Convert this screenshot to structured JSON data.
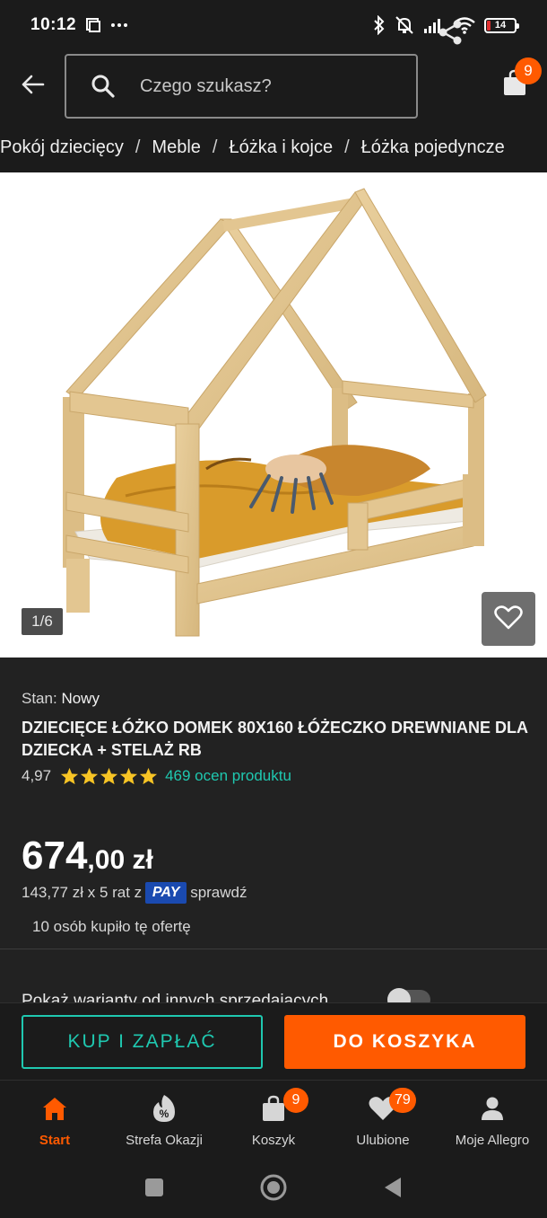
{
  "status_bar": {
    "time": "10:12",
    "battery_level": "14",
    "icons": [
      "screenshot-icon",
      "more-icon",
      "bluetooth-icon",
      "mute-icon",
      "signal-icon",
      "wifi-icon",
      "battery-icon"
    ]
  },
  "header": {
    "search_placeholder": "Czego szukasz?",
    "cart_count": "9"
  },
  "breadcrumb": [
    "Pokój dziecięcy",
    "Meble",
    "Łóżka i kojce",
    "Łóżka pojedyncze"
  ],
  "gallery": {
    "counter": "1/6"
  },
  "product": {
    "condition_label": "Stan:",
    "condition_value": "Nowy",
    "title": "DZIECIĘCE ŁÓŻKO DOMEK 80X160 ŁÓŻECZKO DREWNIANE DLA DZIECKA + STELAŻ RB",
    "rating_value": "4,97",
    "rating_stars": 5,
    "reviews_text": "469 ocen produktu",
    "price_int": "674",
    "price_dec": ",00 zł",
    "installments_text": "143,77 zł x 5 rat z",
    "pay_badge": "PAY",
    "installments_link": "sprawdź",
    "bought_text": "10 osób kupiło tę ofertę",
    "variants_text": "Pokaż warianty od innych sprzedających"
  },
  "actions": {
    "buy_now": "KUP I ZAPŁAĆ",
    "add_to_cart": "DO KOSZYKA"
  },
  "bottom_nav": [
    {
      "label": "Start",
      "icon": "home-icon",
      "active": true
    },
    {
      "label": "Strefa Okazji",
      "icon": "deals-icon"
    },
    {
      "label": "Koszyk",
      "icon": "cart-icon",
      "badge": "9"
    },
    {
      "label": "Ulubione",
      "icon": "heart-icon",
      "badge": "79"
    },
    {
      "label": "Moje Allegro",
      "icon": "user-icon"
    }
  ],
  "colors": {
    "accent": "#ff5a00",
    "teal": "#1fc8b0",
    "background": "#222222"
  }
}
